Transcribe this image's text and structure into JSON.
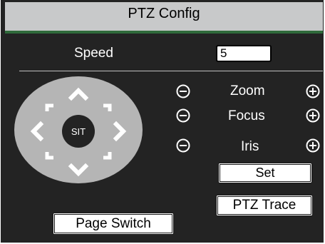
{
  "window": {
    "title": "PTZ Config"
  },
  "speed": {
    "label": "Speed",
    "value": "5"
  },
  "dpad": {
    "center_label": "SIT"
  },
  "controls": [
    {
      "label": "Zoom"
    },
    {
      "label": "Focus"
    },
    {
      "label": "Iris"
    }
  ],
  "buttons": {
    "set": "Set",
    "ptz_trace": "PTZ Trace",
    "page_switch": "Page Switch"
  },
  "colors": {
    "panel_bg": "#232323",
    "titlebar_bg": "#c8c9ca",
    "accent_line": "#2f6a3b",
    "dpad_bg": "#b5b5b5"
  },
  "icons": {
    "minus": "circled-minus-icon",
    "plus": "circled-plus-icon"
  }
}
